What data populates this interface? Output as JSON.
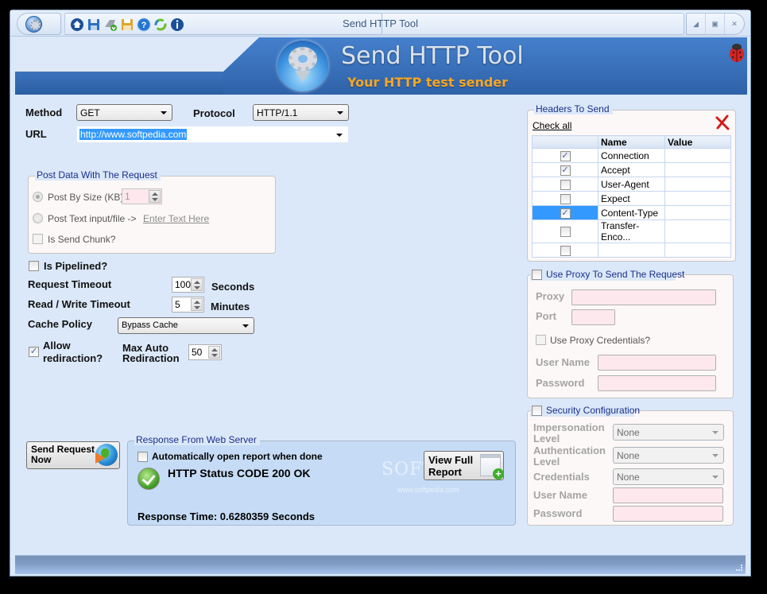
{
  "window": {
    "title": "Send HTTP Tool",
    "quick_access": [
      "home-icon",
      "save-icon",
      "import-icon",
      "save-as-icon",
      "help-icon",
      "refresh-icon",
      "info-icon"
    ],
    "controls": [
      "minimize",
      "maximize",
      "close"
    ]
  },
  "banner": {
    "title": "Send HTTP Tool",
    "subtitle": "Your HTTP test sender"
  },
  "request": {
    "method_label": "Method",
    "method_value": "GET",
    "protocol_label": "Protocol",
    "protocol_value": "HTTP/1.1",
    "url_label": "URL",
    "url_value": "http://www.softpedia.com"
  },
  "post_data": {
    "legend": "Post Data With The Request",
    "post_by_size_label": "Post By Size (KB)",
    "post_by_size_value": "1",
    "post_text_label": "Post Text input/file  ->",
    "enter_text_link": "Enter Text Here",
    "send_chunk_label": "Is Send Chunk?"
  },
  "options": {
    "pipelined_label": "Is Pipelined?",
    "request_timeout_label": "Request Timeout",
    "request_timeout_value": "100",
    "request_timeout_unit": "Seconds",
    "rw_timeout_label": "Read / Write Timeout",
    "rw_timeout_value": "5",
    "rw_timeout_unit": "Minutes",
    "cache_policy_label": "Cache Policy",
    "cache_policy_value": "Bypass Cache",
    "allow_redirect_label_1": "Allow",
    "allow_redirect_label_2": "rediraction?",
    "allow_redirect_checked": true,
    "max_redirect_label_1": "Max Auto",
    "max_redirect_label_2": "Rediraction",
    "max_redirect_value": "50"
  },
  "headers": {
    "legend": "Headers To Send",
    "check_all": "Check all",
    "columns": [
      "",
      "Name",
      "Value"
    ],
    "rows": [
      {
        "checked": true,
        "name": "Connection",
        "value": ""
      },
      {
        "checked": true,
        "name": "Accept",
        "value": ""
      },
      {
        "checked": false,
        "name": "User-Agent",
        "value": ""
      },
      {
        "checked": false,
        "name": "Expect",
        "value": ""
      },
      {
        "checked": true,
        "name": "Content-Type",
        "value": "",
        "selected": true
      },
      {
        "checked": false,
        "name": "Transfer-Enco...",
        "value": ""
      },
      {
        "checked": false,
        "name": "",
        "value": ""
      }
    ]
  },
  "proxy": {
    "legend": "Use Proxy To Send The Request",
    "proxy_label": "Proxy",
    "port_label": "Port",
    "credentials_label": "Use Proxy Credentials?",
    "username_label": "User Name",
    "password_label": "Password"
  },
  "security": {
    "legend": "Security Configuration",
    "impersonation_label_1": "Impersonation",
    "impersonation_label_2": "Level",
    "impersonation_value": "None",
    "authentication_label_1": "Authentication",
    "authentication_label_2": "Level",
    "authentication_value": "None",
    "credentials_label": "Credentials",
    "credentials_value": "None",
    "username_label": "User Name",
    "password_label": "Password"
  },
  "send_button": {
    "line1": "Send Request",
    "line2": "Now"
  },
  "response": {
    "legend": "Response From Web Server",
    "auto_open_label": "Automatically open report when done",
    "status_text": "HTTP Status CODE 200 OK",
    "response_time": "Response Time: 0.6280359 Seconds",
    "view_report_line1": "View Full",
    "view_report_line2": "Report"
  },
  "watermark": {
    "text": "SOFTPEDIA",
    "url": "www.softpedia.com"
  }
}
